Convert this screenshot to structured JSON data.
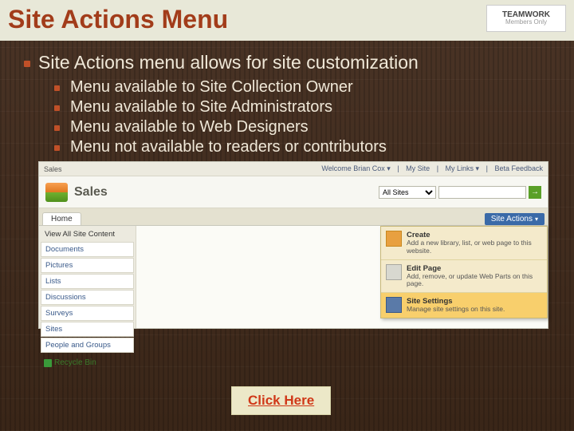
{
  "title": "Site Actions Menu",
  "logo": {
    "line1": "TEAMWORK",
    "line2": "Members Only"
  },
  "main_point": "Site Actions menu allows for site customization",
  "sub_points": [
    "Menu available to Site Collection Owner",
    "Menu available to Site Administrators",
    "Menu available to Web Designers",
    "Menu not available to readers or contributors"
  ],
  "sharepoint": {
    "top": {
      "left": "Sales",
      "welcome": "Welcome Brian Cox ▾",
      "links": [
        "My Site",
        "My Links ▾",
        "Beta Feedback"
      ]
    },
    "site_title": "Sales",
    "search_scope": "All Sites",
    "search_placeholder": "",
    "tab": "Home",
    "actions_button": "Site Actions",
    "nav": [
      "View All Site Content",
      "Documents",
      "Pictures",
      "Lists",
      "Discussions",
      "Surveys",
      "Sites",
      "People and Groups"
    ],
    "recycle": "Recycle Bin",
    "dropdown": [
      {
        "title": "Create",
        "desc": "Add a new library, list, or web page to this website."
      },
      {
        "title": "Edit Page",
        "desc": "Add, remove, or update Web Parts on this page."
      },
      {
        "title": "Site Settings",
        "desc": "Manage site settings on this site."
      }
    ]
  },
  "click_here": "Click Here"
}
